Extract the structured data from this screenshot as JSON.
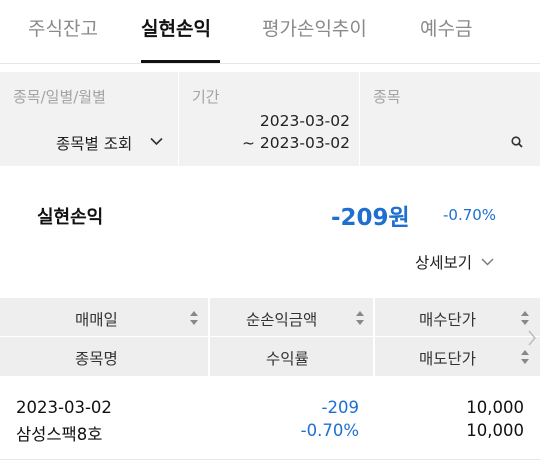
{
  "tabs": [
    {
      "label": "주식잔고",
      "active": false
    },
    {
      "label": "실현손익",
      "active": true
    },
    {
      "label": "평가손익추이",
      "active": false
    },
    {
      "label": "예수금",
      "active": false
    }
  ],
  "filter": {
    "view_label": "종목/일별/월별",
    "view_value": "종목별 조회",
    "period_label": "기간",
    "period_from": "2023-03-02",
    "period_to": "~ 2023-03-02",
    "stock_label": "종목",
    "stock_value": ""
  },
  "summary": {
    "label": "실현손익",
    "value": "-209원",
    "percent": "-0.70%",
    "detail_link": "상세보기"
  },
  "table": {
    "headers_row1": [
      "매매일",
      "순손익금액",
      "매수단가"
    ],
    "headers_row2": [
      "종목명",
      "수익률",
      "매도단가"
    ],
    "rows": [
      {
        "trade_date": "2023-03-02",
        "stock_name": "삼성스팩8호",
        "net_profit": "-209",
        "return_rate": "-0.70%",
        "buy_price": "10,000",
        "sell_price": "10,000"
      }
    ]
  },
  "colors": {
    "accent": "#1e6fd0",
    "panel_bg": "#f2f2f2",
    "header_bg": "#eeeeee"
  },
  "icons": [
    "chevron-down-icon",
    "search-icon",
    "sort-icon",
    "chevron-right-icon"
  ]
}
